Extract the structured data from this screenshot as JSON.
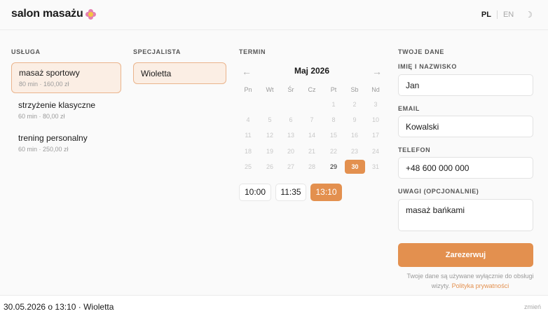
{
  "header": {
    "brand": "salon masażu",
    "lang_pl": "PL",
    "lang_en": "EN"
  },
  "services": {
    "heading": "USŁUGA",
    "items": [
      {
        "name": "masaż sportowy",
        "meta": "80 min · 160,00 zł"
      },
      {
        "name": "strzyżenie klasyczne",
        "meta": "60 min · 80,00 zł"
      },
      {
        "name": "trening personalny",
        "meta": "60 min · 250,00 zł"
      }
    ]
  },
  "specialists": {
    "heading": "SPECJALISTA",
    "items": [
      "Wioletta"
    ]
  },
  "term": {
    "heading": "TERMIN",
    "month": "Maj 2026",
    "weekdays": [
      "Pn",
      "Wt",
      "Śr",
      "Cz",
      "Pt",
      "Sb",
      "Nd"
    ],
    "days": [
      "1",
      "2",
      "3",
      "4",
      "5",
      "6",
      "7",
      "8",
      "9",
      "10",
      "11",
      "12",
      "13",
      "14",
      "15",
      "16",
      "17",
      "18",
      "19",
      "20",
      "21",
      "22",
      "23",
      "24",
      "25",
      "26",
      "27",
      "28",
      "29",
      "30",
      "31"
    ],
    "available_day": "29",
    "selected_day": "30",
    "slots": [
      "10:00",
      "11:35",
      "13:10"
    ],
    "selected_slot": "13:10"
  },
  "form": {
    "heading": "TWOJE DANE",
    "name_label": "IMIĘ I NAZWISKO",
    "name_value": "Jan",
    "email_label": "EMAIL",
    "email_value": "Kowalski",
    "phone_label": "TELEFON",
    "phone_value": "+48 600 000 000",
    "notes_label": "UWAGI (OPCJONALNIE)",
    "notes_value": "masaż bańkami",
    "submit_label": "Zarezerwuj",
    "privacy_text": "Twoje dane są używane wyłącznie do obsługi wizyty.",
    "privacy_link": "Polityka prywatności"
  },
  "footer": {
    "summary": "30.05.2026 o 13:10 · Wioletta",
    "change_label": "zmień"
  },
  "colors": {
    "accent": "#e3904f",
    "accent_bg": "#fbeee4",
    "accent_border": "#eab48c"
  }
}
